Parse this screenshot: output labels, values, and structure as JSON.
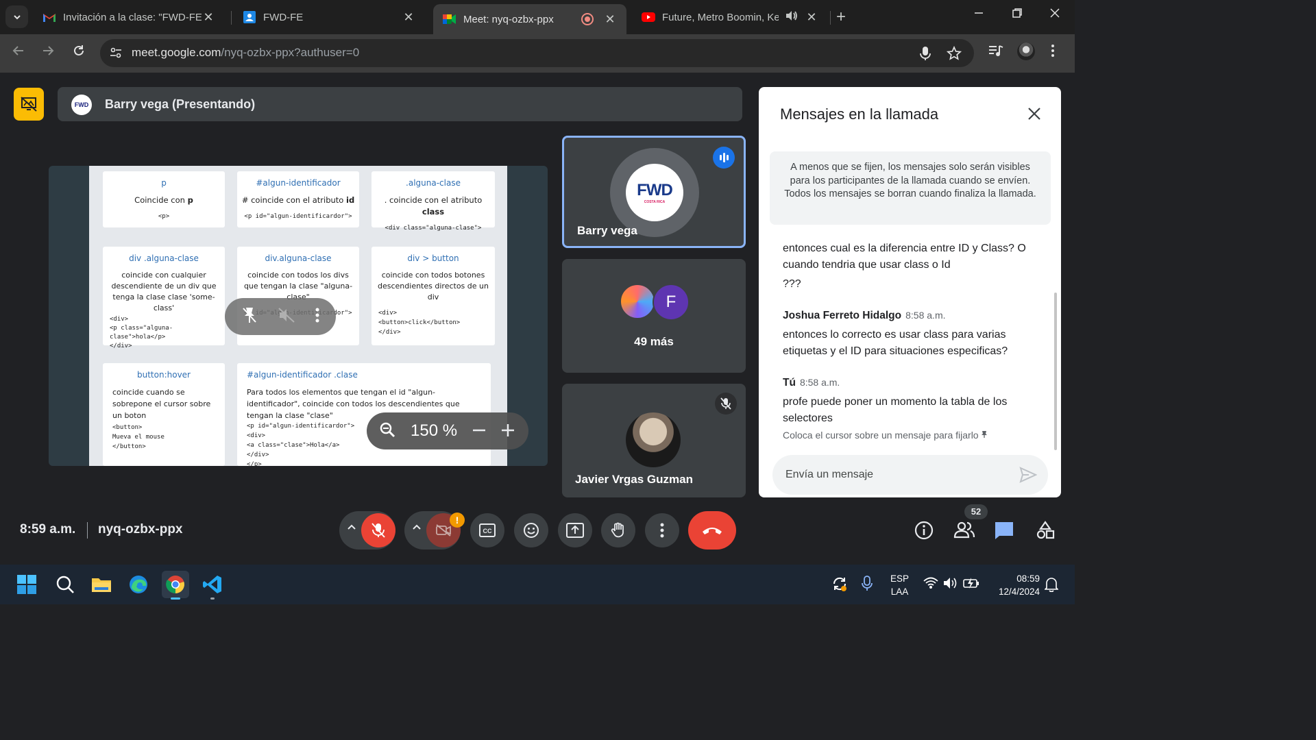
{
  "browser": {
    "tabs": [
      {
        "title": "Invitación a la clase: \"FWD-FE\"",
        "icon": "gmail-icon",
        "active": false
      },
      {
        "title": "FWD-FE",
        "icon": "google-classroom-icon",
        "active": false
      },
      {
        "title": "Meet: nyq-ozbx-ppx",
        "icon": "google-meet-icon",
        "active": true
      },
      {
        "title": "Future, Metro Boomin, Kend",
        "icon": "youtube-icon",
        "active": false
      }
    ],
    "url_host": "meet.google.com",
    "url_path": "/nyq-ozbx-ppx?authuser=0"
  },
  "meet": {
    "presenter_label": "Barry vega (Presentando)",
    "presenter_logo_text": "FWD",
    "zoom_level": "150 %",
    "slide": {
      "cards": [
        {
          "heading": "p",
          "desc_pre": "Coincide con ",
          "desc_bold": "p",
          "code": [
            "<p>"
          ]
        },
        {
          "heading": "#algun-identificador",
          "desc_pre": "# coincide con el atributo ",
          "desc_bold": "id",
          "code": [
            "<p id=\"algun-identificardor\">"
          ]
        },
        {
          "heading": ".alguna-clase",
          "desc_pre": ". coincide con el atributo ",
          "desc_bold": "class",
          "code": [
            "<div class=\"alguna-clase\">"
          ]
        },
        {
          "heading": "div .alguna-clase",
          "desc": "coincide con cualquier descendiente de un div que tenga la clase clase 'some-class'",
          "code": [
            "<div>",
            " <p class=\"alguna-clase\">hola</p>",
            "</div>"
          ]
        },
        {
          "heading": "div.alguna-clase",
          "desc": "coincide con todos los divs que tengan la clase \"alguna-clase\"",
          "code": [
            "<p id=\"algun-identificardor\">"
          ]
        },
        {
          "heading": "div > button",
          "desc": "coincide con todos botones descendientes directos de un div",
          "code": [
            "<div>",
            "  <button>click</button>",
            "</div>"
          ]
        },
        {
          "heading": "button:hover",
          "desc": "coincide cuando se sobrepone el cursor sobre un boton",
          "code": [
            "<button>",
            "  Mueva el mouse",
            "</button>"
          ]
        },
        {
          "heading": "#algun-identificador .clase",
          "desc": "Para todos los elementos que tengan el id \"algun-identificador\", coincide con todos los descendientes que tengan la clase \"clase\"",
          "code": [
            "<p id=\"algun-identificardor\">",
            "  <div>",
            "    <a class=\"clase\">Hola</a>",
            "  </div>",
            "</p>"
          ]
        }
      ]
    },
    "participants": {
      "main_tile_name": "Barry vega",
      "main_tile_logo": "FWD",
      "main_tile_logo_sub": "COSTA RICA",
      "group_initial": "F",
      "group_more": "49 más",
      "third_tile_name": "Javier Vrgas Guzman"
    },
    "bottom": {
      "time": "8:59 a.m.",
      "meeting_code": "nyq-ozbx-ppx",
      "people_count": "52",
      "cc_label": "CC"
    }
  },
  "chat": {
    "title": "Mensajes en la llamada",
    "notice": "A menos que se fijen, los mensajes solo serán visibles para los participantes de la llamada cuando se envíen. Todos los mensajes se borran cuando finaliza la llamada.",
    "messages": [
      {
        "sender": "",
        "time": "",
        "lines": [
          "entonces cual es la diferencia entre ID y Class? O cuando tendria que usar class o Id",
          "???"
        ]
      },
      {
        "sender": "Joshua Ferreto Hidalgo",
        "time": "8:58 a.m.",
        "lines": [
          "entonces lo correcto es usar class para varias etiquetas y el ID para situaciones especificas?"
        ]
      },
      {
        "sender": "Tú",
        "time": "8:58 a.m.",
        "lines": [
          "profe puede poner un momento la tabla de  los selectores"
        ]
      }
    ],
    "pin_hint": "Coloca el cursor sobre un mensaje para fijarlo",
    "input_placeholder": "Envía un mensaje"
  },
  "taskbar": {
    "lang_1": "ESP",
    "lang_2": "LAA",
    "time": "08:59",
    "date": "12/4/2024"
  },
  "colors": {
    "meet_bg": "#202124",
    "tile_bg": "#3c4043",
    "accent_blue": "#8ab4f8",
    "danger_red": "#ea4335",
    "present_yellow": "#fbbc04"
  }
}
